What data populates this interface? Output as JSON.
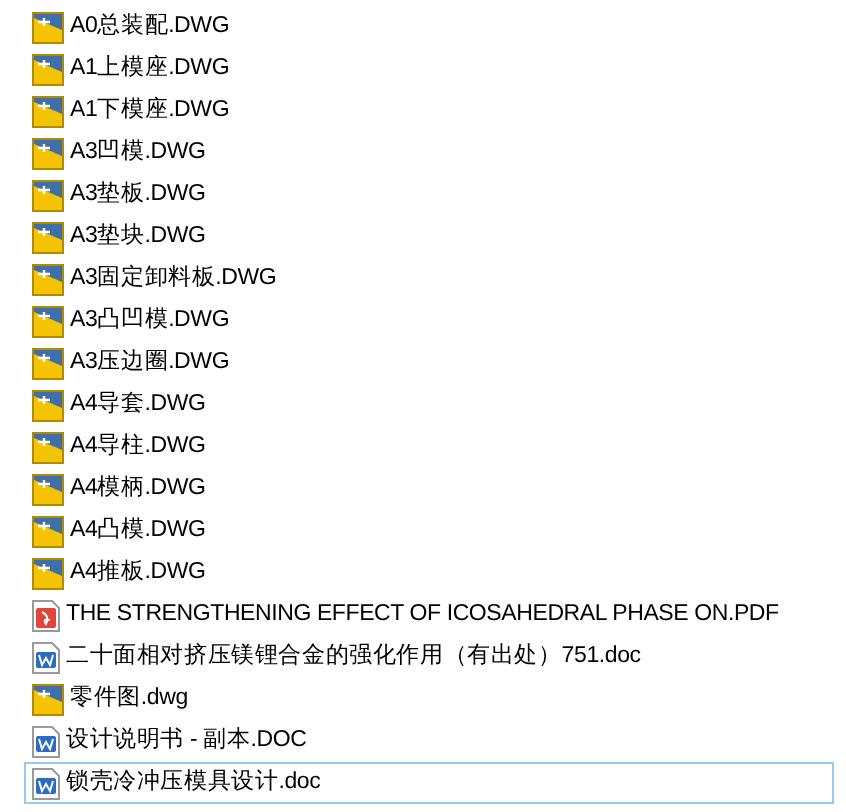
{
  "files": [
    {
      "name": "A0总装配.DWG",
      "kind": "dwg",
      "focused": false
    },
    {
      "name": "A1上模座.DWG",
      "kind": "dwg",
      "focused": false
    },
    {
      "name": "A1下模座.DWG",
      "kind": "dwg",
      "focused": false
    },
    {
      "name": "A3凹模.DWG",
      "kind": "dwg",
      "focused": false
    },
    {
      "name": "A3垫板.DWG",
      "kind": "dwg",
      "focused": false
    },
    {
      "name": "A3垫块.DWG",
      "kind": "dwg",
      "focused": false
    },
    {
      "name": "A3固定卸料板.DWG",
      "kind": "dwg",
      "focused": false
    },
    {
      "name": "A3凸凹模.DWG",
      "kind": "dwg",
      "focused": false
    },
    {
      "name": "A3压边圈.DWG",
      "kind": "dwg",
      "focused": false
    },
    {
      "name": "A4导套.DWG",
      "kind": "dwg",
      "focused": false
    },
    {
      "name": "A4导柱.DWG",
      "kind": "dwg",
      "focused": false
    },
    {
      "name": "A4模柄.DWG",
      "kind": "dwg",
      "focused": false
    },
    {
      "name": "A4凸模.DWG",
      "kind": "dwg",
      "focused": false
    },
    {
      "name": "A4推板.DWG",
      "kind": "dwg",
      "focused": false
    },
    {
      "name": "THE STRENGTHENING EFFECT OF ICOSAHEDRAL PHASE ON.PDF",
      "kind": "pdf",
      "focused": false
    },
    {
      "name": "二十面相对挤压镁锂合金的强化作用（有出处）751.doc",
      "kind": "doc",
      "focused": false
    },
    {
      "name": "零件图.dwg",
      "kind": "dwg",
      "focused": false
    },
    {
      "name": "设计说明书 - 副本.DOC",
      "kind": "doc",
      "focused": false
    },
    {
      "name": "锁壳冷冲压模具设计.doc",
      "kind": "doc",
      "focused": true
    }
  ]
}
